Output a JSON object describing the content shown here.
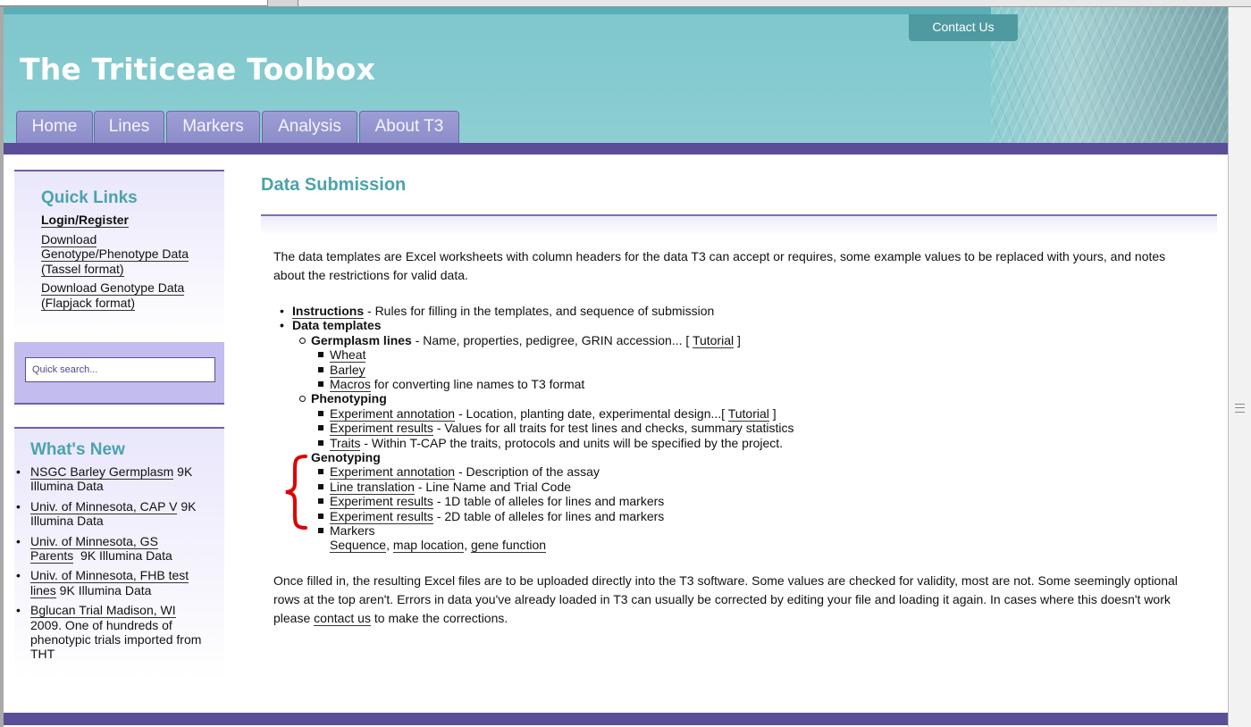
{
  "header": {
    "site_title": "The Triticeae Toolbox",
    "contact_label": "Contact Us",
    "nav": [
      "Home",
      "Lines",
      "Markers",
      "Analysis",
      "About T3"
    ]
  },
  "sidebar": {
    "quick_links_title": "Quick Links",
    "login_label": "Login/Register",
    "download_gp_lines": [
      "Download",
      "Genotype/Phenotype Data",
      "(Tassel format)"
    ],
    "download_g_lines": [
      "Download Genotype Data",
      "(Flapjack format)"
    ],
    "search_placeholder": "Quick search...",
    "whats_new_title": "What's New",
    "news": [
      {
        "link_lines": [
          "NSGC Barley Germplasm"
        ],
        "rest_first": " 9K",
        "rest_lines": [
          "Illumina Data"
        ]
      },
      {
        "link_lines": [
          "Univ. of Minnesota, CAP V"
        ],
        "rest_first": " 9K",
        "rest_lines": [
          "Illumina Data"
        ]
      },
      {
        "link_lines": [
          "Univ. of Minnesota, GS",
          "Parents"
        ],
        "rest_first": "  9K Illumina Data",
        "rest_lines": []
      },
      {
        "link_lines": [
          "Univ. of Minnesota, FHB test",
          "lines"
        ],
        "rest_first": " 9K Illumina Data",
        "rest_lines": []
      },
      {
        "link_lines": [
          "Bglucan Trial Madison, WI"
        ],
        "rest_first": "",
        "rest_lines": [
          "2009. One of hundreds of",
          "phenotypic trials imported from",
          "THT"
        ]
      }
    ]
  },
  "main": {
    "title": "Data Submission",
    "intro_line1": "The data templates are Excel worksheets with column headers for the data T3 can accept or requires, some example values to be replaced with yours, and notes",
    "intro_line2": "about the restrictions for valid data.",
    "instructions_link": "Instructions",
    "instructions_text": " - Rules for filling in the templates, and sequence of submission",
    "data_templates": "Data templates",
    "germplasm_label": "Germplasm lines",
    "germplasm_text": " - Name, properties, pedigree, GRIN accession... [ ",
    "tutorial": "Tutorial",
    "tutorial_close": " ]",
    "wheat": "Wheat",
    "barley": "Barley",
    "macros": "Macros",
    "macros_text": " for converting line names to T3 format",
    "phenotyping": "Phenotyping",
    "exp_annotation": "Experiment annotation",
    "pheno_annot_text": " - Location, planting date, experimental design...[ ",
    "tutorial_close2": " ]",
    "exp_results": "Experiment results",
    "pheno_results_text": " - Values for all traits for test lines and checks, summary statistics",
    "traits": "Traits",
    "traits_text": " - Within T-CAP the traits, protocols and units will be specified by the project.",
    "genotyping": "Genotyping",
    "geno_annot_text": " - Description of the assay",
    "line_translation": "Line translation",
    "line_translation_text": " - Line Name and Trial Code",
    "geno_results_1d": " - 1D table of alleles for lines and markers",
    "geno_results_2d": " - 2D table of alleles for lines and markers",
    "markers": "Markers",
    "sequence": "Sequence",
    "map_location": "map location",
    "gene_function": "gene function",
    "comma": ", ",
    "outro_line1": "Once filled in, the resulting Excel files are to be uploaded directly into the T3 software. Some values are checked for validity, most are not. Some seemingly optional",
    "outro_line2": "rows at the top aren't. Errors in data you've already loaded in T3 can usually be corrected by editing your file and loading it again. In cases where this doesn't work",
    "outro_line3_pre": "please ",
    "contact_link": "contact us",
    "outro_line3_post": " to make the corrections."
  },
  "colors": {
    "header_teal": "#86cbd0",
    "nav_purple": "#5c4d98",
    "title_teal": "#4aa3ad",
    "brace_red": "#e00000"
  }
}
